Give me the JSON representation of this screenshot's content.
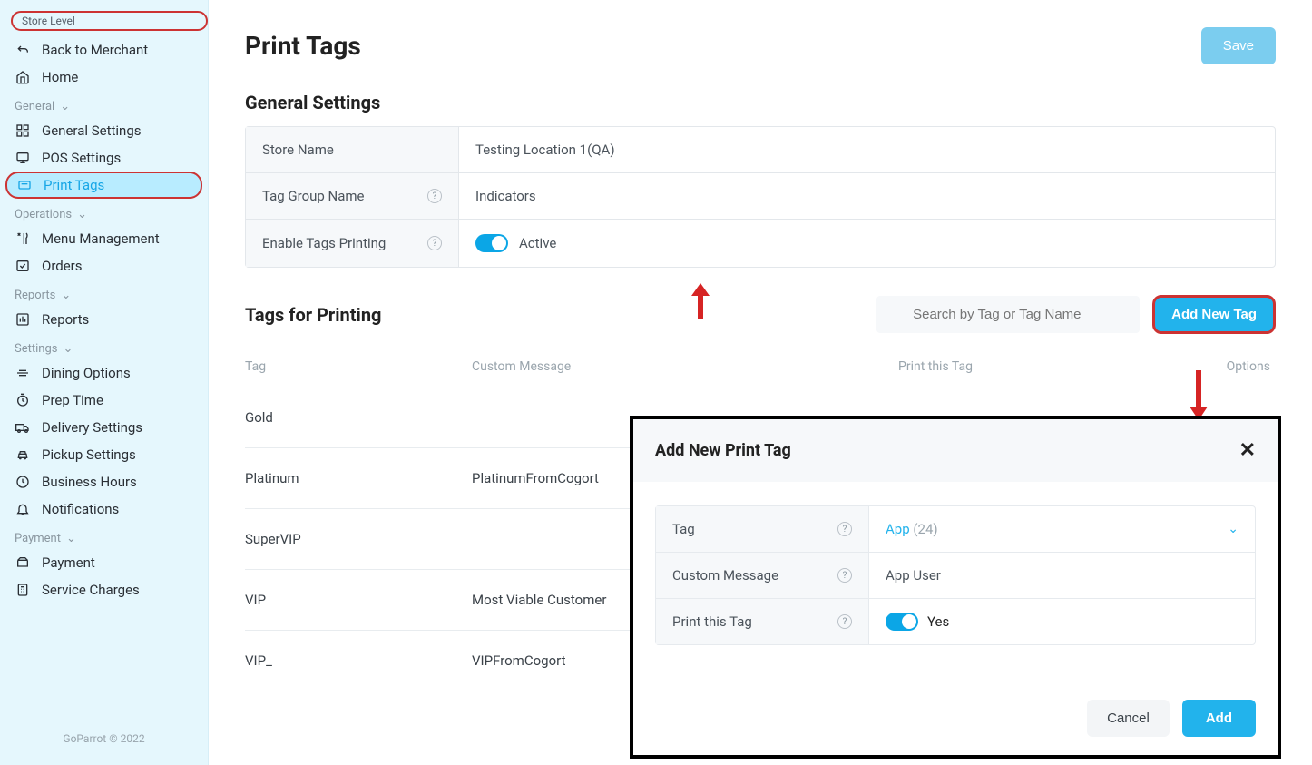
{
  "sidebar": {
    "store_level_label": "Store Level",
    "back_label": "Back to Merchant",
    "home_label": "Home",
    "groups": {
      "general": {
        "header": "General",
        "items": [
          "General Settings",
          "POS Settings",
          "Print Tags"
        ]
      },
      "operations": {
        "header": "Operations",
        "items": [
          "Menu Management",
          "Orders"
        ]
      },
      "reports": {
        "header": "Reports",
        "items": [
          "Reports"
        ]
      },
      "settings": {
        "header": "Settings",
        "items": [
          "Dining Options",
          "Prep Time",
          "Delivery Settings",
          "Pickup Settings",
          "Business Hours",
          "Notifications"
        ]
      },
      "payment": {
        "header": "Payment",
        "items": [
          "Payment",
          "Service Charges"
        ]
      }
    },
    "footer": "GoParrot © 2022"
  },
  "header": {
    "title": "Print Tags",
    "save": "Save"
  },
  "general_settings": {
    "section_title": "General Settings",
    "store_name_label": "Store Name",
    "store_name_value": "Testing Location 1(QA)",
    "tag_group_label": "Tag Group Name",
    "tag_group_value": "Indicators",
    "enable_label": "Enable Tags Printing",
    "enable_status": "Active"
  },
  "tags_section": {
    "title": "Tags for Printing",
    "search_placeholder": "Search by Tag or Tag Name",
    "add_button": "Add New Tag",
    "columns": {
      "tag": "Tag",
      "message": "Custom Message",
      "print": "Print this Tag",
      "options": "Options"
    },
    "rows": [
      {
        "tag": "Gold",
        "message": ""
      },
      {
        "tag": "Platinum",
        "message": "PlatinumFromCogort"
      },
      {
        "tag": "SuperVIP",
        "message": ""
      },
      {
        "tag": "VIP",
        "message": "Most Viable Customer"
      },
      {
        "tag": "VIP_",
        "message": "VIPFromCogort"
      }
    ]
  },
  "modal": {
    "title": "Add New Print Tag",
    "tag_label": "Tag",
    "tag_value_name": "App",
    "tag_value_count": "(24)",
    "message_label": "Custom Message",
    "message_value": "App User",
    "print_label": "Print this Tag",
    "print_value": "Yes",
    "cancel": "Cancel",
    "add": "Add"
  }
}
